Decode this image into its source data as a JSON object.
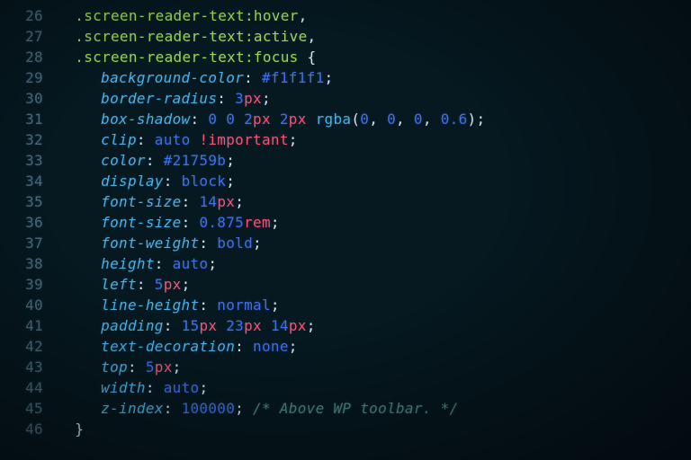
{
  "gutter": {
    "start": 26,
    "end": 46
  },
  "selectors": [
    {
      "class": ".screen-reader-text",
      "pseudo": ":hover",
      "trail": ","
    },
    {
      "class": ".screen-reader-text",
      "pseudo": ":active",
      "trail": ","
    },
    {
      "class": ".screen-reader-text",
      "pseudo": ":focus",
      "trail": " {"
    }
  ],
  "rules": [
    {
      "prop": "background-color",
      "tokens": [
        {
          "t": "hex",
          "v": "#f1f1f1"
        }
      ]
    },
    {
      "prop": "border-radius",
      "tokens": [
        {
          "t": "num",
          "v": "3"
        },
        {
          "t": "unit",
          "v": "px"
        }
      ]
    },
    {
      "prop": "box-shadow",
      "tokens": [
        {
          "t": "num",
          "v": "0"
        },
        {
          "t": "sp"
        },
        {
          "t": "num",
          "v": "0"
        },
        {
          "t": "sp"
        },
        {
          "t": "num",
          "v": "2"
        },
        {
          "t": "unit",
          "v": "px"
        },
        {
          "t": "sp"
        },
        {
          "t": "num",
          "v": "2"
        },
        {
          "t": "unit",
          "v": "px"
        },
        {
          "t": "sp"
        },
        {
          "t": "fn",
          "v": "rgba"
        },
        {
          "t": "paren",
          "v": "("
        },
        {
          "t": "num",
          "v": "0"
        },
        {
          "t": "comma",
          "v": ", "
        },
        {
          "t": "num",
          "v": "0"
        },
        {
          "t": "comma",
          "v": ", "
        },
        {
          "t": "num",
          "v": "0"
        },
        {
          "t": "comma",
          "v": ", "
        },
        {
          "t": "num",
          "v": "0.6"
        },
        {
          "t": "paren",
          "v": ")"
        }
      ]
    },
    {
      "prop": "clip",
      "tokens": [
        {
          "t": "ident",
          "v": "auto"
        },
        {
          "t": "sp"
        },
        {
          "t": "important",
          "v": "!important"
        }
      ]
    },
    {
      "prop": "color",
      "tokens": [
        {
          "t": "hex",
          "v": "#21759b"
        }
      ]
    },
    {
      "prop": "display",
      "tokens": [
        {
          "t": "ident",
          "v": "block"
        }
      ]
    },
    {
      "prop": "font-size",
      "tokens": [
        {
          "t": "num",
          "v": "14"
        },
        {
          "t": "unit",
          "v": "px"
        }
      ]
    },
    {
      "prop": "font-size",
      "tokens": [
        {
          "t": "num",
          "v": "0.875"
        },
        {
          "t": "unit",
          "v": "rem"
        }
      ]
    },
    {
      "prop": "font-weight",
      "tokens": [
        {
          "t": "ident",
          "v": "bold"
        }
      ]
    },
    {
      "prop": "height",
      "tokens": [
        {
          "t": "ident",
          "v": "auto"
        }
      ]
    },
    {
      "prop": "left",
      "tokens": [
        {
          "t": "num",
          "v": "5"
        },
        {
          "t": "unit",
          "v": "px"
        }
      ]
    },
    {
      "prop": "line-height",
      "tokens": [
        {
          "t": "ident",
          "v": "normal"
        }
      ]
    },
    {
      "prop": "padding",
      "tokens": [
        {
          "t": "num",
          "v": "15"
        },
        {
          "t": "unit",
          "v": "px"
        },
        {
          "t": "sp"
        },
        {
          "t": "num",
          "v": "23"
        },
        {
          "t": "unit",
          "v": "px"
        },
        {
          "t": "sp"
        },
        {
          "t": "num",
          "v": "14"
        },
        {
          "t": "unit",
          "v": "px"
        }
      ]
    },
    {
      "prop": "text-decoration",
      "tokens": [
        {
          "t": "ident",
          "v": "none"
        }
      ]
    },
    {
      "prop": "top",
      "tokens": [
        {
          "t": "num",
          "v": "5"
        },
        {
          "t": "unit",
          "v": "px"
        }
      ]
    },
    {
      "prop": "width",
      "tokens": [
        {
          "t": "ident",
          "v": "auto"
        }
      ]
    },
    {
      "prop": "z-index",
      "tokens": [
        {
          "t": "num",
          "v": "100000"
        }
      ],
      "comment": "/* Above WP toolbar. */"
    }
  ],
  "close_brace": "}"
}
